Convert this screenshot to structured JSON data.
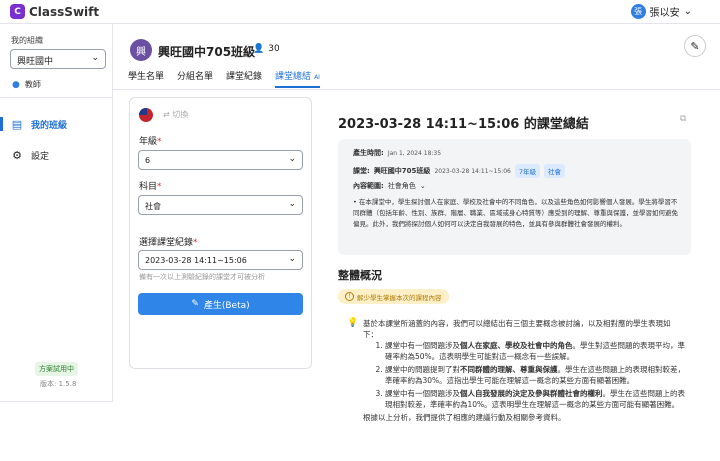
{
  "app": {
    "logo_initial": "C",
    "name": "ClassSwift"
  },
  "user": {
    "avatar_initial": "張",
    "name": "張以安",
    "menu_icon": "chevron-down-icon"
  },
  "sidebar": {
    "org_label": "我的組織",
    "org_value": "興旺國中",
    "role": "教師",
    "nav": [
      {
        "label": "我的班級",
        "icon": "classroom-icon",
        "active": true
      },
      {
        "label": "設定",
        "icon": "gear-icon",
        "active": false
      }
    ],
    "plan_badge": "方案試用中",
    "version": "版本: 1.5.8"
  },
  "header": {
    "class_logo": "興",
    "class_title": "興旺國中705班級",
    "student_count": "30",
    "tabs": [
      {
        "label": "學生名單",
        "active": false
      },
      {
        "label": "分組名單",
        "active": false
      },
      {
        "label": "課堂紀錄",
        "active": false
      },
      {
        "label": "課堂總結",
        "active": true,
        "badge": "AI"
      }
    ]
  },
  "form": {
    "switch_label": "切換",
    "grade_label": "年級",
    "grade_value": "6",
    "subject_label": "科目",
    "subject_value": "社會",
    "record_label": "選擇課堂紀錄",
    "record_value": "2023-03-28  14:11~15:06",
    "hint": "備有一次以上測驗紀錄的課堂才可被分析",
    "generate_label": "產生(Beta)"
  },
  "summary": {
    "title": "2023-03-28  14:11~15:06 的課堂總結",
    "produced_label": "產生時間:",
    "produced_value": "Jan 1, 2024 18:35",
    "lesson_label": "課堂:",
    "lesson_class": "興旺國中705班級",
    "lesson_time": "2023-03-28  14:11~15:06",
    "grade_badge": "7年級",
    "subject_badge": "社會",
    "scope_label": "內容範圍:",
    "scope_value": "社會角色",
    "scope_text": "在本課堂中，學生探討個人在家庭、學校及社會中的不同角色，以及這些角色如何影響個人發展。學生將學習不同群體（包括年齡、性別、族群、階層、職業、區域或身心特質等）應受到的理解、尊重與保護，並學習如何避免偏見。此外，我們將探討個人如何可以決定自我發展的特色，並具有參與群體社會發展的權利。"
  },
  "overview": {
    "title": "整體概況",
    "pill": "解少學生掌握本次的課程內容",
    "intro": "基於本課堂所涵蓋的內容，我們可以總結出有三個主要概念被討論，以及相對應的學生表現如下：",
    "items": [
      {
        "pre": "課堂中有一個問題涉及",
        "bold": "個人在家庭、學校及社會中的角色",
        "post": "。學生對這些問題的表現平均，準確率約為50%。這表明學生可能對這一概念有一些誤解。"
      },
      {
        "pre": "課堂中的問題提到了對",
        "bold": "不同群體的理解、尊重與保護",
        "post": "。學生在這些問題上的表現相對較差，準確率約為30%。這指出學生可能在理解這一概念的某些方面有顯著困難。"
      },
      {
        "pre": "課堂中有一個問題涉及",
        "bold": "個人自我發展的決定及參與群體社會的權利",
        "post": "。學生在這些問題上的表現相對較差，準確率約為10%。這表明學生在理解這一概念的某些方面可能有顯著困難。"
      }
    ],
    "closing": "根據以上分析，我們提供了相應的建議行動及相關參考資料。"
  }
}
